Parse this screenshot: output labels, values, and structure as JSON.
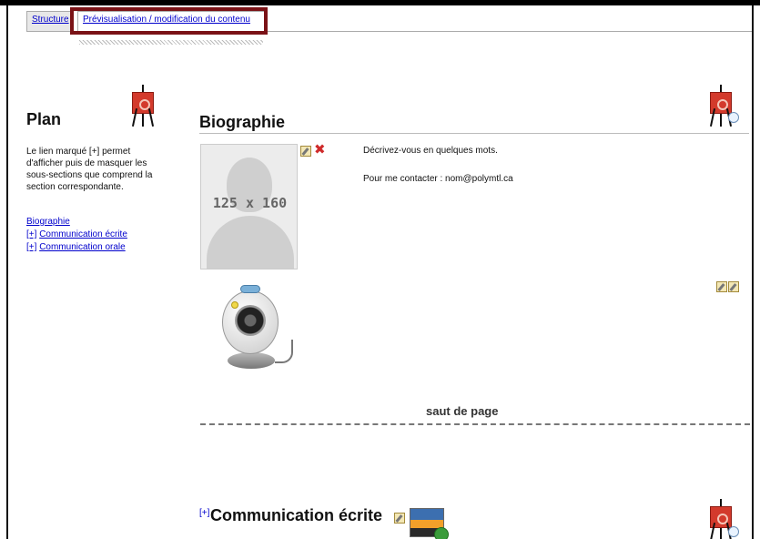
{
  "tabs": {
    "structure": "Structure",
    "preview": "Prévisualisation / modification du contenu"
  },
  "plan": {
    "title": "Plan",
    "description": "Le lien marqué [+] permet d'afficher puis de masquer les sous-sections que comprend la section correspondante.",
    "links": [
      {
        "prefix": "",
        "label": "Biographie"
      },
      {
        "prefix": "[+]",
        "label": "Communication écrite"
      },
      {
        "prefix": "[+]",
        "label": "Communication orale"
      }
    ]
  },
  "main": {
    "section_title": "Biographie",
    "photo_placeholder": "125 x 160",
    "bio_line_1": "Décrivez-vous en quelques mots.",
    "bio_line_2": "Pour me contacter : nom@polymtl.ca",
    "page_break": "saut de page",
    "next_section_expand": "[+]",
    "next_section_title": "Communication écrite"
  },
  "icons": {
    "easel": "easel-icon",
    "edit": "edit-icon",
    "delete": "delete-icon",
    "webcam": "webcam-icon",
    "image": "image-icon"
  },
  "colors": {
    "highlight_border": "#7a1216",
    "link": "#0000cc",
    "easel_board": "#d33a2c"
  }
}
